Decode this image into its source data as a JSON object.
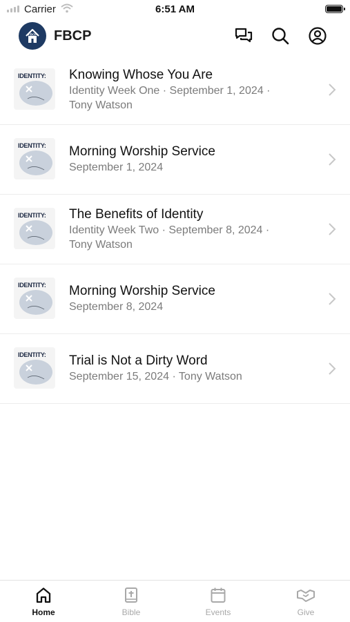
{
  "status_bar": {
    "carrier": "Carrier",
    "time": "6:51 AM"
  },
  "header": {
    "logo_text": "FBCP",
    "title": "FBCP"
  },
  "thumbnail_text": "IDENTITY:",
  "items": [
    {
      "title": "Knowing Whose You Are",
      "subtitle_line1": "Identity Week One · September 1, 2024 ·",
      "subtitle_line2": "Tony Watson"
    },
    {
      "title": "Morning Worship Service",
      "subtitle_line1": "September 1, 2024",
      "subtitle_line2": ""
    },
    {
      "title": "The Benefits of Identity",
      "subtitle_line1": "Identity Week Two · September 8, 2024 ·",
      "subtitle_line2": "Tony Watson"
    },
    {
      "title": "Morning Worship Service",
      "subtitle_line1": "September 8, 2024",
      "subtitle_line2": ""
    },
    {
      "title": "Trial is Not a Dirty Word",
      "subtitle_line1": "September 15, 2024 · Tony Watson",
      "subtitle_line2": ""
    }
  ],
  "tabs": [
    {
      "label": "Home",
      "icon": "home-icon",
      "active": true
    },
    {
      "label": "Bible",
      "icon": "bible-icon",
      "active": false
    },
    {
      "label": "Events",
      "icon": "calendar-icon",
      "active": false
    },
    {
      "label": "Give",
      "icon": "give-icon",
      "active": false
    }
  ],
  "colors": {
    "brand": "#1e3a63",
    "inactive": "#a8a8a8",
    "subtitle": "#7b7b7b"
  }
}
